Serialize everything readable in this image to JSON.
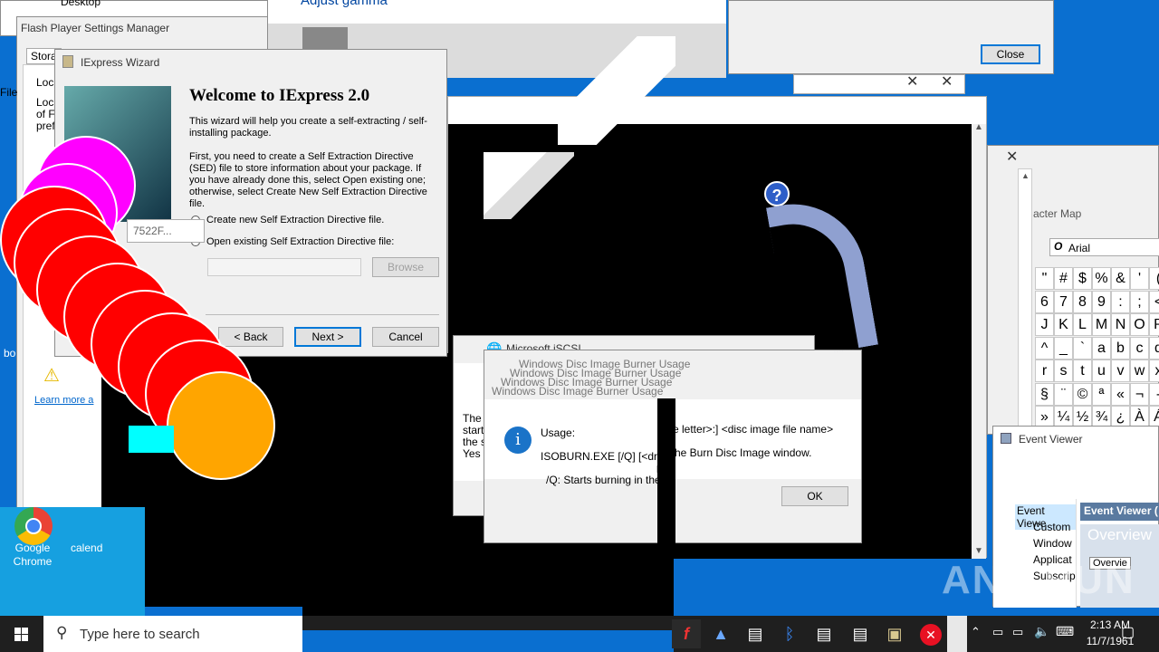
{
  "flash": {
    "title": "Flash Player Settings Manager",
    "tab": "Stora",
    "lines": [
      "Loca",
      "Loca",
      "of Fl",
      "pref"
    ],
    "file_label": "File"
  },
  "iexpress": {
    "title": "IExpress Wizard",
    "heading": "Welcome to IExpress 2.0",
    "p1": "This wizard will help you create a self-extracting / self-installing package.",
    "p2": "First, you need to create a Self Extraction Directive (SED) file to store information about your package.  If you have already done this, select Open existing one; otherwise, select Create New Self Extraction Directive file.",
    "opt_create": "Create new Self Extraction Directive file.",
    "opt_open": "Open existing Self Extraction Directive file:",
    "browse": "Browse",
    "back": "< Back",
    "next": "Next >",
    "cancel": "Cancel",
    "fragment": "7522F..."
  },
  "top": {
    "adjust_gamma": "Adjust gamma",
    "close": "Close"
  },
  "charmap": {
    "title": "acter Map",
    "font": "Arial",
    "chars": [
      "\"",
      "#",
      "$",
      "%",
      "&",
      "'",
      "(",
      "6",
      "7",
      "8",
      "9",
      ":",
      ";",
      "<",
      "J",
      "K",
      "L",
      "M",
      "N",
      "O",
      "P",
      "^",
      "_",
      "`",
      "a",
      "b",
      "c",
      "d",
      "r",
      "s",
      "t",
      "u",
      "v",
      "w",
      "x",
      "§",
      "¨",
      "©",
      "ª",
      "«",
      "¬",
      "-",
      "»",
      "¼",
      "½",
      "¾",
      "¿",
      "À",
      "Á"
    ]
  },
  "eventviewer": {
    "title": "Event Viewer",
    "tree": [
      "Event Viewe",
      "Custom",
      "Window",
      "Applicat",
      "Subscrip"
    ],
    "header": "Event Viewer (",
    "overview": "Overview",
    "overview_tab": "Overvie"
  },
  "iscsi": {
    "title": "Microsoft iSCSI",
    "lines": [
      "The",
      "start",
      "the s",
      "Yes b"
    ]
  },
  "isoburn": {
    "titles": [
      "Windows Disc Image Burner Usage",
      "Windows Disc Image Burner Usage",
      "Windows Disc Image Burner Usage",
      "Windows Disc Image Burner Usage"
    ],
    "usage": "Usage:",
    "line1": "ISOBURN.EXE [/Q] [<drive",
    "line1b": "ve letter>:] <disc image file name>",
    "line2b": "he Burn Disc Image window.",
    "line3": "/Q: Starts burning in the",
    "ok": "OK",
    "frag_ve": "ve",
    "frag_he": "he"
  },
  "desktop": {
    "chrome_label": "Google Chrome",
    "calendar_label": "calend",
    "bo_label": "bo",
    "learn_more": "Learn more a",
    "desktop_label": "Desktop",
    "frag_d": ")"
  },
  "taskbar": {
    "search_placeholder": "Type here to search",
    "time": "2:13 AM",
    "date": "11/7/1961"
  },
  "watermark": "ANY RUN",
  "colors": {
    "accent": "#0078d7",
    "red_ball": "#ff0000",
    "magenta_ball": "#ff00ff",
    "orange_ball": "#ffa500",
    "cyan": "#00ffff",
    "taskbar": "#1f1f1f"
  }
}
